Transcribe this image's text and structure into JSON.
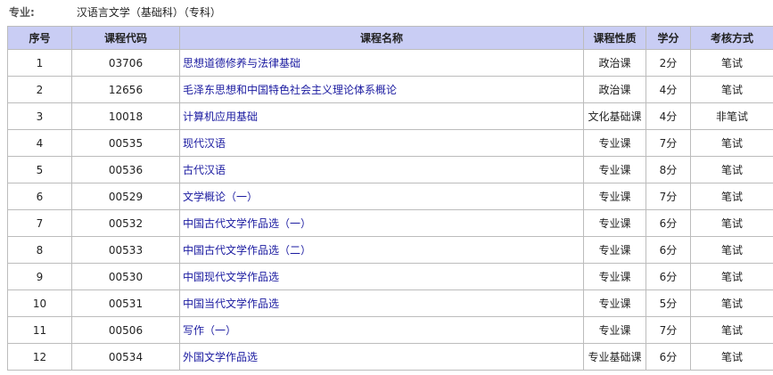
{
  "major": {
    "label": "专业:",
    "value": "汉语言文学（基础科）（专科）"
  },
  "table": {
    "headers": {
      "seq": "序号",
      "code": "课程代码",
      "name": "课程名称",
      "type": "课程性质",
      "credit": "学分",
      "exam": "考核方式"
    },
    "rows": [
      {
        "seq": "1",
        "code": "03706",
        "name": "思想道德修养与法律基础",
        "type": "政治课",
        "credit": "2分",
        "exam": "笔试"
      },
      {
        "seq": "2",
        "code": "12656",
        "name": "毛泽东思想和中国特色社会主义理论体系概论",
        "type": "政治课",
        "credit": "4分",
        "exam": "笔试"
      },
      {
        "seq": "3",
        "code": "10018",
        "name": "计算机应用基础",
        "type": "文化基础课",
        "credit": "4分",
        "exam": "非笔试"
      },
      {
        "seq": "4",
        "code": "00535",
        "name": "现代汉语",
        "type": "专业课",
        "credit": "7分",
        "exam": "笔试"
      },
      {
        "seq": "5",
        "code": "00536",
        "name": "古代汉语",
        "type": "专业课",
        "credit": "8分",
        "exam": "笔试"
      },
      {
        "seq": "6",
        "code": "00529",
        "name": "文学概论（一）",
        "type": "专业课",
        "credit": "7分",
        "exam": "笔试"
      },
      {
        "seq": "7",
        "code": "00532",
        "name": "中国古代文学作品选（一）",
        "type": "专业课",
        "credit": "6分",
        "exam": "笔试"
      },
      {
        "seq": "8",
        "code": "00533",
        "name": "中国古代文学作品选（二）",
        "type": "专业课",
        "credit": "6分",
        "exam": "笔试"
      },
      {
        "seq": "9",
        "code": "00530",
        "name": "中国现代文学作品选",
        "type": "专业课",
        "credit": "6分",
        "exam": "笔试"
      },
      {
        "seq": "10",
        "code": "00531",
        "name": "中国当代文学作品选",
        "type": "专业课",
        "credit": "5分",
        "exam": "笔试"
      },
      {
        "seq": "11",
        "code": "00506",
        "name": "写作（一）",
        "type": "专业课",
        "credit": "7分",
        "exam": "笔试"
      },
      {
        "seq": "12",
        "code": "00534",
        "name": "外国文学作品选",
        "type": "专业基础课",
        "credit": "6分",
        "exam": "笔试"
      }
    ]
  },
  "colors": {
    "header_bg": "#c9cdf4",
    "link": "#1a1aa0",
    "border": "#bcbcbc"
  }
}
